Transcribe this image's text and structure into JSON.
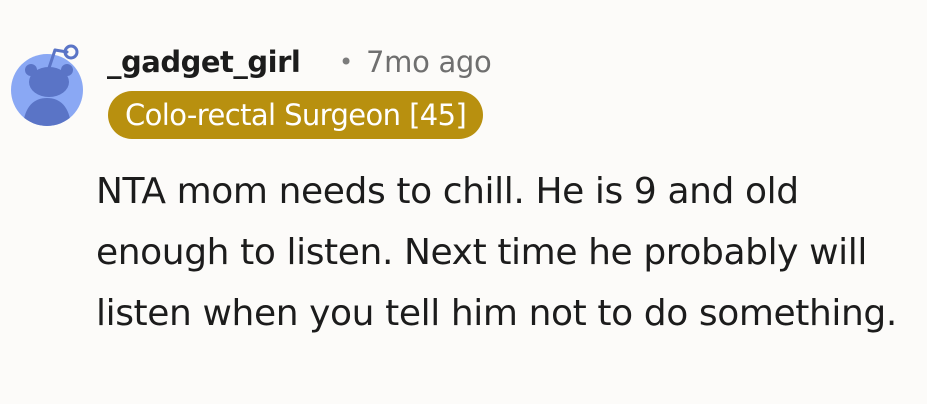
{
  "comment": {
    "author": "_gadget_girl",
    "separator": "•",
    "timestamp": "7mo ago",
    "flair": "Colo-rectal Surgeon [45]",
    "body": "NTA mom needs to chill. He is 9 and old enough to listen. Next time he probably will listen when you tell him not to do something."
  },
  "avatar": {
    "icon": "snoo-avatar-icon",
    "background_color": "#8aa8f4",
    "figure_color": "#5a74c6"
  },
  "colors": {
    "page_background": "#fcfbf9",
    "flair_background": "#b8900f",
    "flair_text": "#ffffff",
    "text_primary": "#1c1c1c",
    "text_secondary": "#6f6f6f"
  }
}
